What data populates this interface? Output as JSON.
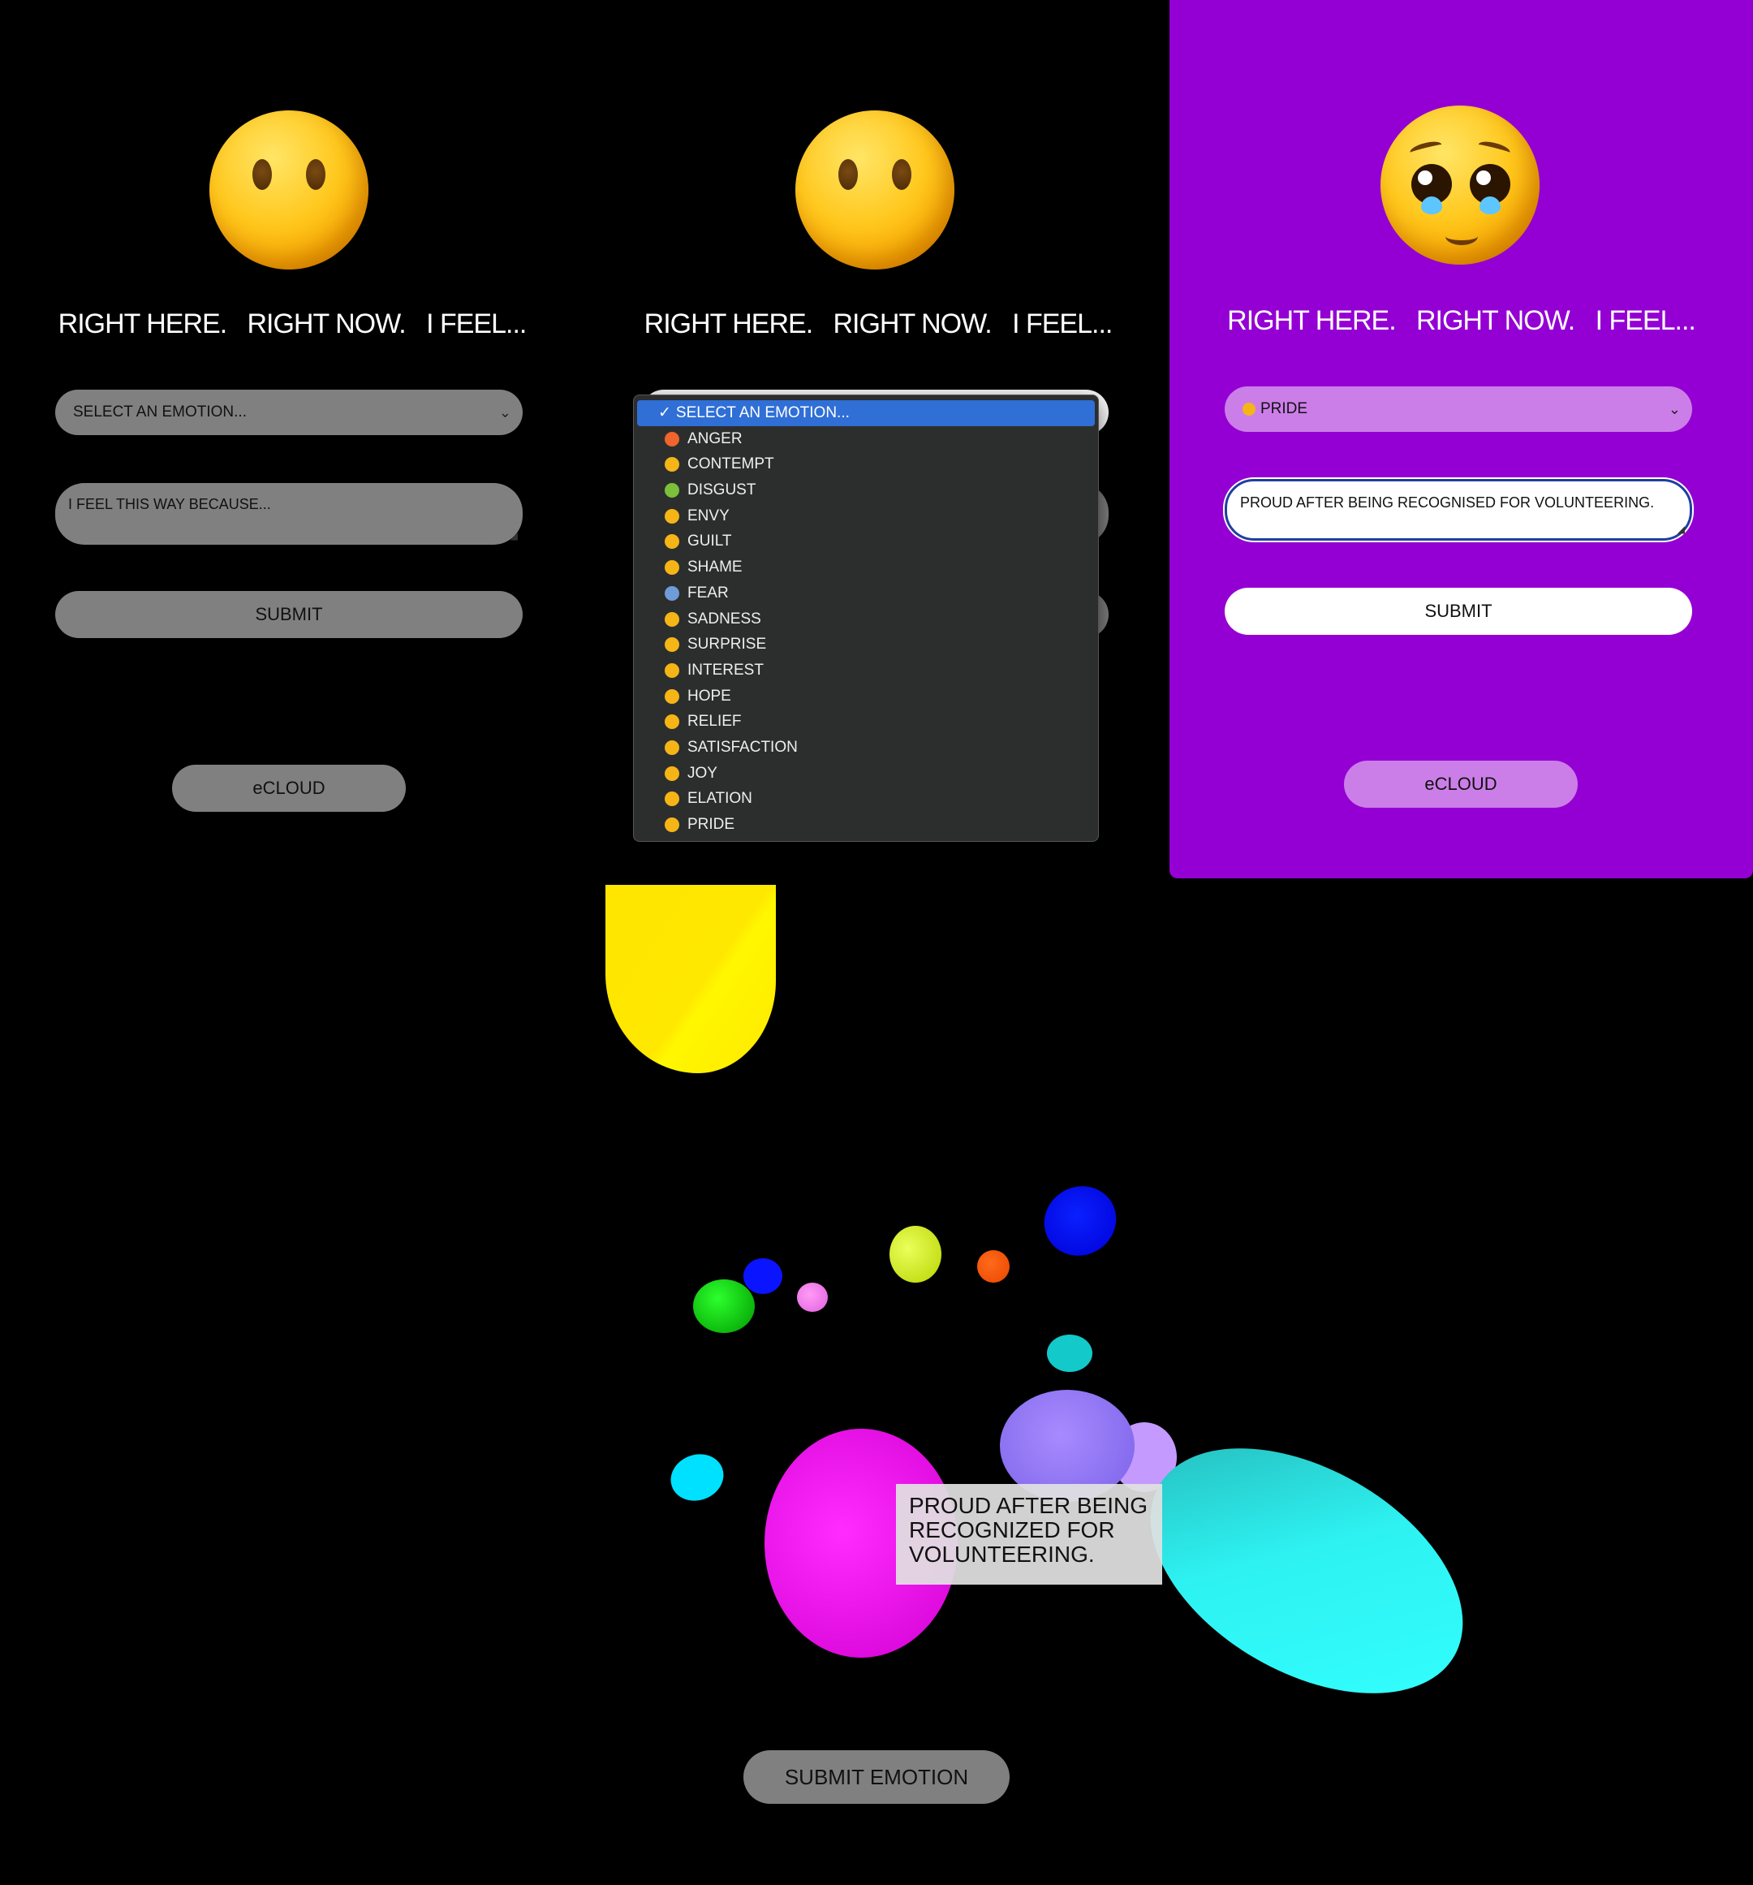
{
  "heading": "RIGHT HERE.   RIGHT NOW.   I FEEL...",
  "form_default": {
    "select_placeholder": "SELECT AN EMOTION...",
    "textarea_placeholder": "I FEEL THIS WAY BECAUSE...",
    "submit_label": "SUBMIT",
    "ecloud_label": "eCLOUD"
  },
  "dropdown": {
    "options": [
      {
        "label": "SELECT AN EMOTION...",
        "selected": true,
        "icon": "checkmark",
        "color": ""
      },
      {
        "label": "ANGER",
        "icon": "angry-face-icon",
        "color": "#f0642d"
      },
      {
        "label": "CONTEMPT",
        "icon": "unamused-face-icon",
        "color": "#f5b516"
      },
      {
        "label": "DISGUST",
        "icon": "nauseated-face-icon",
        "color": "#7bbf3a"
      },
      {
        "label": "ENVY",
        "icon": "grimace-face-icon",
        "color": "#f5b516"
      },
      {
        "label": "GUILT",
        "icon": "worried-face-icon",
        "color": "#f5b516"
      },
      {
        "label": "SHAME",
        "icon": "flushed-face-icon",
        "color": "#f5b516"
      },
      {
        "label": "FEAR",
        "icon": "fearful-face-icon",
        "color": "#6f9bd8"
      },
      {
        "label": "SADNESS",
        "icon": "crying-face-icon",
        "color": "#f5b516"
      },
      {
        "label": "SURPRISE",
        "icon": "astonished-face-icon",
        "color": "#f5b516"
      },
      {
        "label": "INTEREST",
        "icon": "thinking-face-icon",
        "color": "#f5b516"
      },
      {
        "label": "HOPE",
        "icon": "smiling-face-icon",
        "color": "#f5b516"
      },
      {
        "label": "RELIEF",
        "icon": "relieved-face-icon",
        "color": "#f5b516"
      },
      {
        "label": "SATISFACTION",
        "icon": "blush-face-icon",
        "color": "#f5b516"
      },
      {
        "label": "JOY",
        "icon": "grinning-face-icon",
        "color": "#f5b516"
      },
      {
        "label": "ELATION",
        "icon": "smiling-eyes-face-icon",
        "color": "#f5b516"
      },
      {
        "label": "PRIDE",
        "icon": "pleading-face-icon",
        "color": "#f5b516"
      }
    ]
  },
  "form_filled": {
    "selected_emotion": "PRIDE",
    "textarea_value": "PROUD AFTER BEING RECOGNISED FOR VOLUNTEERING.",
    "submit_label": "SUBMIT",
    "ecloud_label": "eCLOUD",
    "panel_color": "#9400d3"
  },
  "cloud": {
    "tooltip_text": "PROUD AFTER BEING RECOGNIZED FOR VOLUNTEERING.",
    "submit_emotion_label": "SUBMIT EMOTION"
  }
}
